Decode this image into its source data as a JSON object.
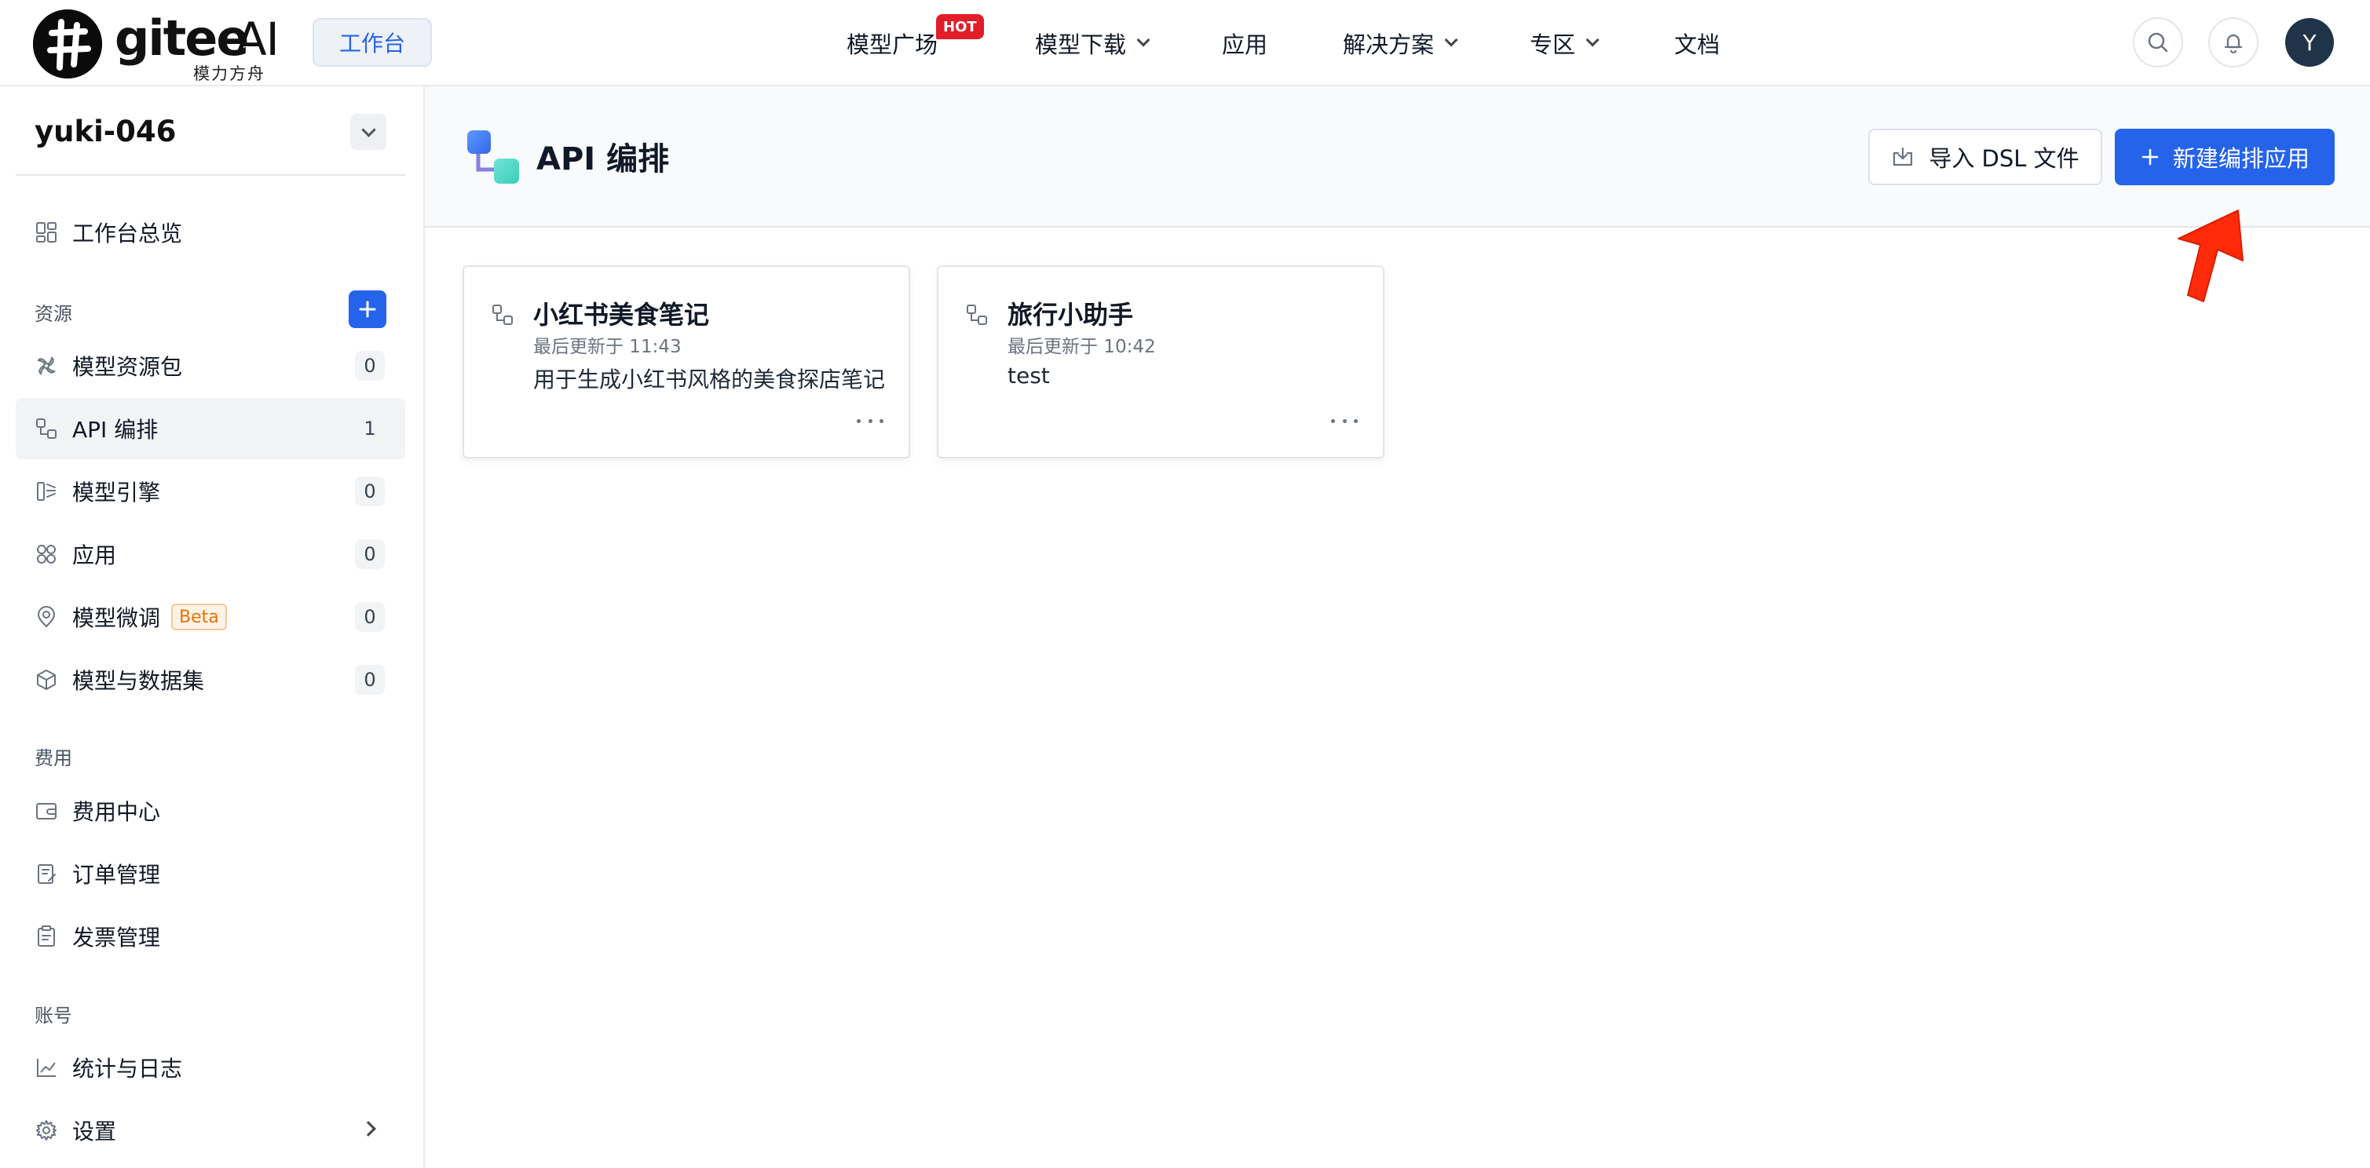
{
  "header": {
    "logo_text": "gitee",
    "logo_ai": "AI",
    "logo_sub": "模力方舟",
    "workbench_label": "工作台",
    "nav": [
      {
        "label": "模型广场",
        "badge": "HOT"
      },
      {
        "label": "模型下载"
      },
      {
        "label": "应用"
      },
      {
        "label": "解决方案"
      },
      {
        "label": "专区"
      },
      {
        "label": "文档"
      }
    ],
    "avatar_letter": "Y"
  },
  "sidebar": {
    "user_name": "yuki-046",
    "overview_label": "工作台总览",
    "section_resources": "资源",
    "resources": [
      {
        "label": "模型资源包",
        "count": "0",
        "icon": "pinwheel-icon"
      },
      {
        "label": "API 编排",
        "count": "1",
        "icon": "workflow-icon",
        "active": true
      },
      {
        "label": "模型引擎",
        "count": "0",
        "icon": "engine-icon"
      },
      {
        "label": "应用",
        "count": "0",
        "icon": "apps-grid-icon"
      },
      {
        "label": "模型微调",
        "count": "0",
        "icon": "finetune-icon",
        "badge": "Beta"
      },
      {
        "label": "模型与数据集",
        "count": "0",
        "icon": "cube-icon"
      }
    ],
    "section_billing": "费用",
    "billing": [
      {
        "label": "费用中心",
        "icon": "wallet-icon"
      },
      {
        "label": "订单管理",
        "icon": "order-icon"
      },
      {
        "label": "发票管理",
        "icon": "invoice-icon"
      }
    ],
    "section_account": "账号",
    "account": [
      {
        "label": "统计与日志",
        "icon": "chart-line-icon"
      },
      {
        "label": "设置",
        "icon": "gear-icon"
      }
    ]
  },
  "main": {
    "title": "API 编排",
    "import_label": "导入 DSL 文件",
    "new_label": "新建编排应用",
    "cards": [
      {
        "title": "小红书美食笔记",
        "time": "最后更新于 11:43",
        "desc": "用于生成小红书风格的美食探店笔记"
      },
      {
        "title": "旅行小助手",
        "time": "最后更新于 10:42",
        "desc": "test"
      }
    ]
  },
  "colors": {
    "accent": "#2563eb",
    "hot": "#e11d2a",
    "beta": "#e8710a",
    "pointer_arrow": "#ff2a0a"
  }
}
